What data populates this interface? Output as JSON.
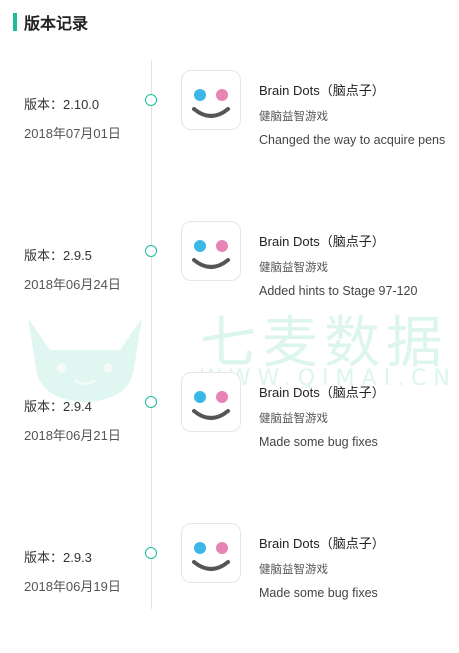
{
  "header": {
    "title": "版本记录"
  },
  "watermark": {
    "text": "七麦数据",
    "url": "WWW.QIMAI.CN"
  },
  "entries": [
    {
      "version": "版本：2.10.0",
      "date": "2018年07月01日",
      "app_name": "Brain Dots（脑点子）",
      "category": "健脑益智游戏",
      "note": "Changed the way to acquire pens"
    },
    {
      "version": "版本：2.9.5",
      "date": "2018年06月24日",
      "app_name": "Brain Dots（脑点子）",
      "category": "健脑益智游戏",
      "note": "Added hints to Stage 97-120"
    },
    {
      "version": "版本：2.9.4",
      "date": "2018年06月21日",
      "app_name": "Brain Dots（脑点子）",
      "category": "健脑益智游戏",
      "note": "Made some bug fixes"
    },
    {
      "version": "版本：2.9.3",
      "date": "2018年06月19日",
      "app_name": "Brain Dots（脑点子）",
      "category": "健脑益智游戏",
      "note": "Made some bug fixes"
    }
  ],
  "colors": {
    "accent": "#1bbc9b",
    "dot_blue": "#3bb7e8",
    "dot_pink": "#e884b3",
    "smile": "#555555"
  },
  "icons": {
    "app": "brain-dots-app-icon",
    "watermark": "cat-logo-icon"
  }
}
